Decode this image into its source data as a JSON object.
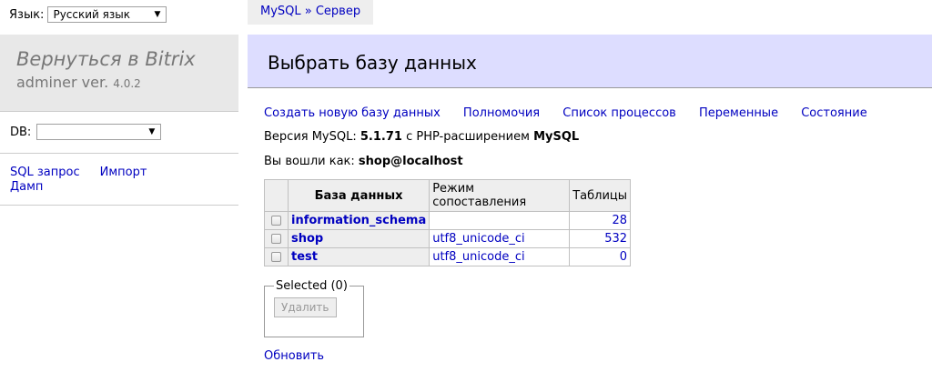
{
  "sidebar": {
    "lang_label": "Язык:",
    "lang_value": "Русский язык",
    "back_link": "Вернуться в Bitrix",
    "app_name": "adminer ver.",
    "version": "4.0.2",
    "db_label": "DB:",
    "db_value": "",
    "links": [
      {
        "label": "SQL запрос"
      },
      {
        "label": "Импорт"
      },
      {
        "label": "Дамп"
      }
    ]
  },
  "breadcrumb": {
    "text": "MySQL » Сервер"
  },
  "header": {
    "title": "Выбрать базу данных"
  },
  "actions": [
    {
      "label": "Создать новую базу данных"
    },
    {
      "label": "Полномочия"
    },
    {
      "label": "Список процессов"
    },
    {
      "label": "Переменные"
    },
    {
      "label": "Состояние"
    }
  ],
  "info": {
    "version_prefix": "Версия MySQL:",
    "version": "5.1.71",
    "ext_prefix": "с PHP-расширением",
    "ext": "MySQL",
    "login_prefix": "Вы вошли как:",
    "login": "shop@localhost"
  },
  "table": {
    "headers": [
      "База данных",
      "Режим сопоставления",
      "Таблицы"
    ],
    "rows": [
      {
        "name": "information_schema",
        "collation": "",
        "tables": "28"
      },
      {
        "name": "shop",
        "collation": "utf8_unicode_ci",
        "tables": "532"
      },
      {
        "name": "test",
        "collation": "utf8_unicode_ci",
        "tables": "0"
      }
    ]
  },
  "selected": {
    "legend": "Selected (0)",
    "delete_label": "Удалить"
  },
  "refresh_label": "Обновить"
}
